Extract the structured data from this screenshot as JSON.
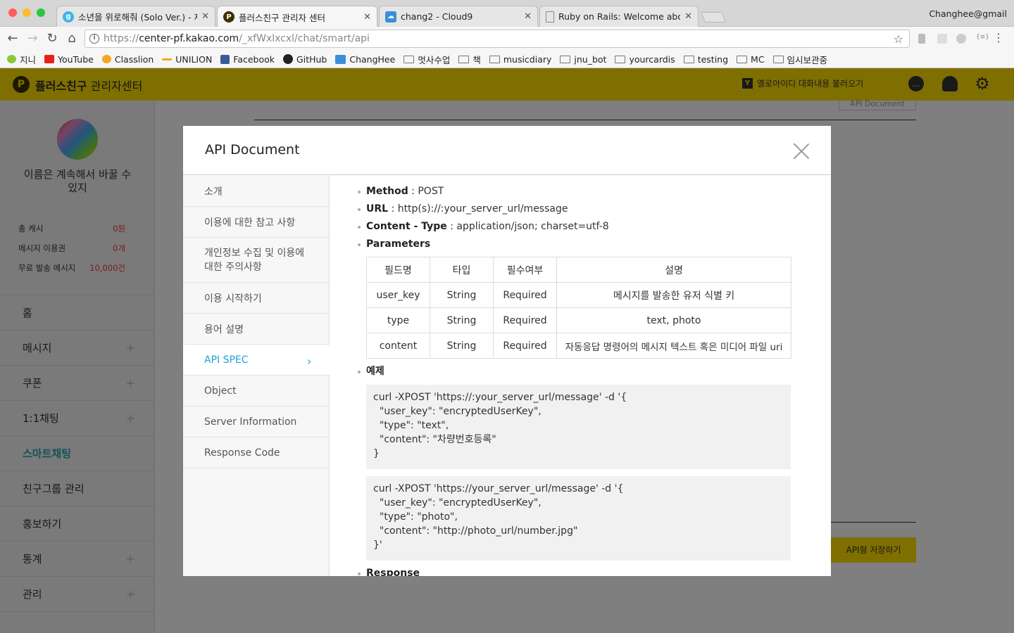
{
  "browser": {
    "tabs": [
      {
        "title": "소년을 위로해줘 (Solo Ver.) - 제",
        "icon": "melon-icon",
        "color": "#3fb4ea"
      },
      {
        "title": "플러스친구 관리자 센터",
        "icon": "plusfriend-icon",
        "color": "#3d3000"
      },
      {
        "title": "chang2 - Cloud9",
        "icon": "cloud9-icon",
        "color": "#3b8fd8"
      },
      {
        "title": "Ruby on Rails: Welcome aboard",
        "icon": "document-icon",
        "color": "#888888"
      }
    ],
    "close_glyph": "✕",
    "profile": "Changhee@gmail",
    "url_scheme": "https://",
    "url_host": "center-pf.kakao.com",
    "url_path": "/_xfWxlxcxl/chat/smart/api",
    "bookmarks": [
      "지니",
      "YouTube",
      "Classlion",
      "UNILION",
      "Facebook",
      "GitHub",
      "ChangHee",
      "멋사수업",
      "책",
      "musicdiary",
      "jnu_bot",
      "yourcardis",
      "testing",
      "MC",
      "임시보관중"
    ]
  },
  "app": {
    "logo_glyph": "P",
    "title_bold": "플러스친구",
    "title_rest": " 관리자센터",
    "import_label": "옐로아이디 대화내용 불러오기",
    "brand_color": "#ffde00"
  },
  "sidebar": {
    "profile_name": "이름은 계속해서 바꿀 수 있지",
    "stats": [
      {
        "label": "총 캐시",
        "value": "0원"
      },
      {
        "label": "메시지 이용권",
        "value": "0개"
      },
      {
        "label": "무료 발송 메시지",
        "value": "10,000건"
      }
    ],
    "nav": [
      {
        "label": "홈",
        "plus": false
      },
      {
        "label": "메시지",
        "plus": true
      },
      {
        "label": "쿠폰",
        "plus": true
      },
      {
        "label": "1:1채팅",
        "plus": true
      },
      {
        "label": "스마트채팅",
        "plus": false,
        "active": true
      },
      {
        "label": "친구그룹 관리",
        "plus": false
      },
      {
        "label": "홍보하기",
        "plus": false
      },
      {
        "label": "통계",
        "plus": true
      },
      {
        "label": "관리",
        "plus": true
      }
    ]
  },
  "background": {
    "doc_button": "API Document",
    "save_button": "API형 저장하기"
  },
  "modal": {
    "title": "API Document",
    "nav": [
      {
        "label": "소개"
      },
      {
        "label": "이용에 대한 참고 사항"
      },
      {
        "label": "개인정보 수집 및 이용에 대한 주의사항"
      },
      {
        "label": "이용 시작하기"
      },
      {
        "label": "용어 설명"
      },
      {
        "label": "API SPEC",
        "active": true
      },
      {
        "label": "Object"
      },
      {
        "label": "Server Information"
      },
      {
        "label": "Response Code"
      }
    ],
    "spec": {
      "method_label": "Method",
      "method_value": " : POST",
      "url_label": "URL",
      "url_value": " : http(s)://:your_server_url/message",
      "ctype_label": "Content - Type",
      "ctype_value": " : application/json; charset=utf-8",
      "params_label": "Parameters",
      "table_headers": [
        "필드명",
        "타입",
        "필수여부",
        "설명"
      ],
      "table_rows": [
        [
          "user_key",
          "String",
          "Required",
          "메시지를 발송한 유저 식별 키"
        ],
        [
          "type",
          "String",
          "Required",
          "text, photo"
        ],
        [
          "content",
          "String",
          "Required",
          "자동응답 명령어의 메시지 텍스트 혹은 미디어 파일 uri"
        ]
      ],
      "example_label": "예제",
      "code1": "curl -XPOST 'https://:your_server_url/message' -d '{\n  \"user_key\": \"encryptedUserKey\",\n  \"type\": \"text\",\n  \"content\": \"차량번호등록\"\n}",
      "code2": "curl -XPOST 'https://your_server_url/message' -d '{\n  \"user_key\": \"encryptedUserKey\",\n  \"type\": \"photo\",\n  \"content\": \"http://photo_url/number.jpg\"\n}'",
      "response_label": "Response"
    }
  }
}
